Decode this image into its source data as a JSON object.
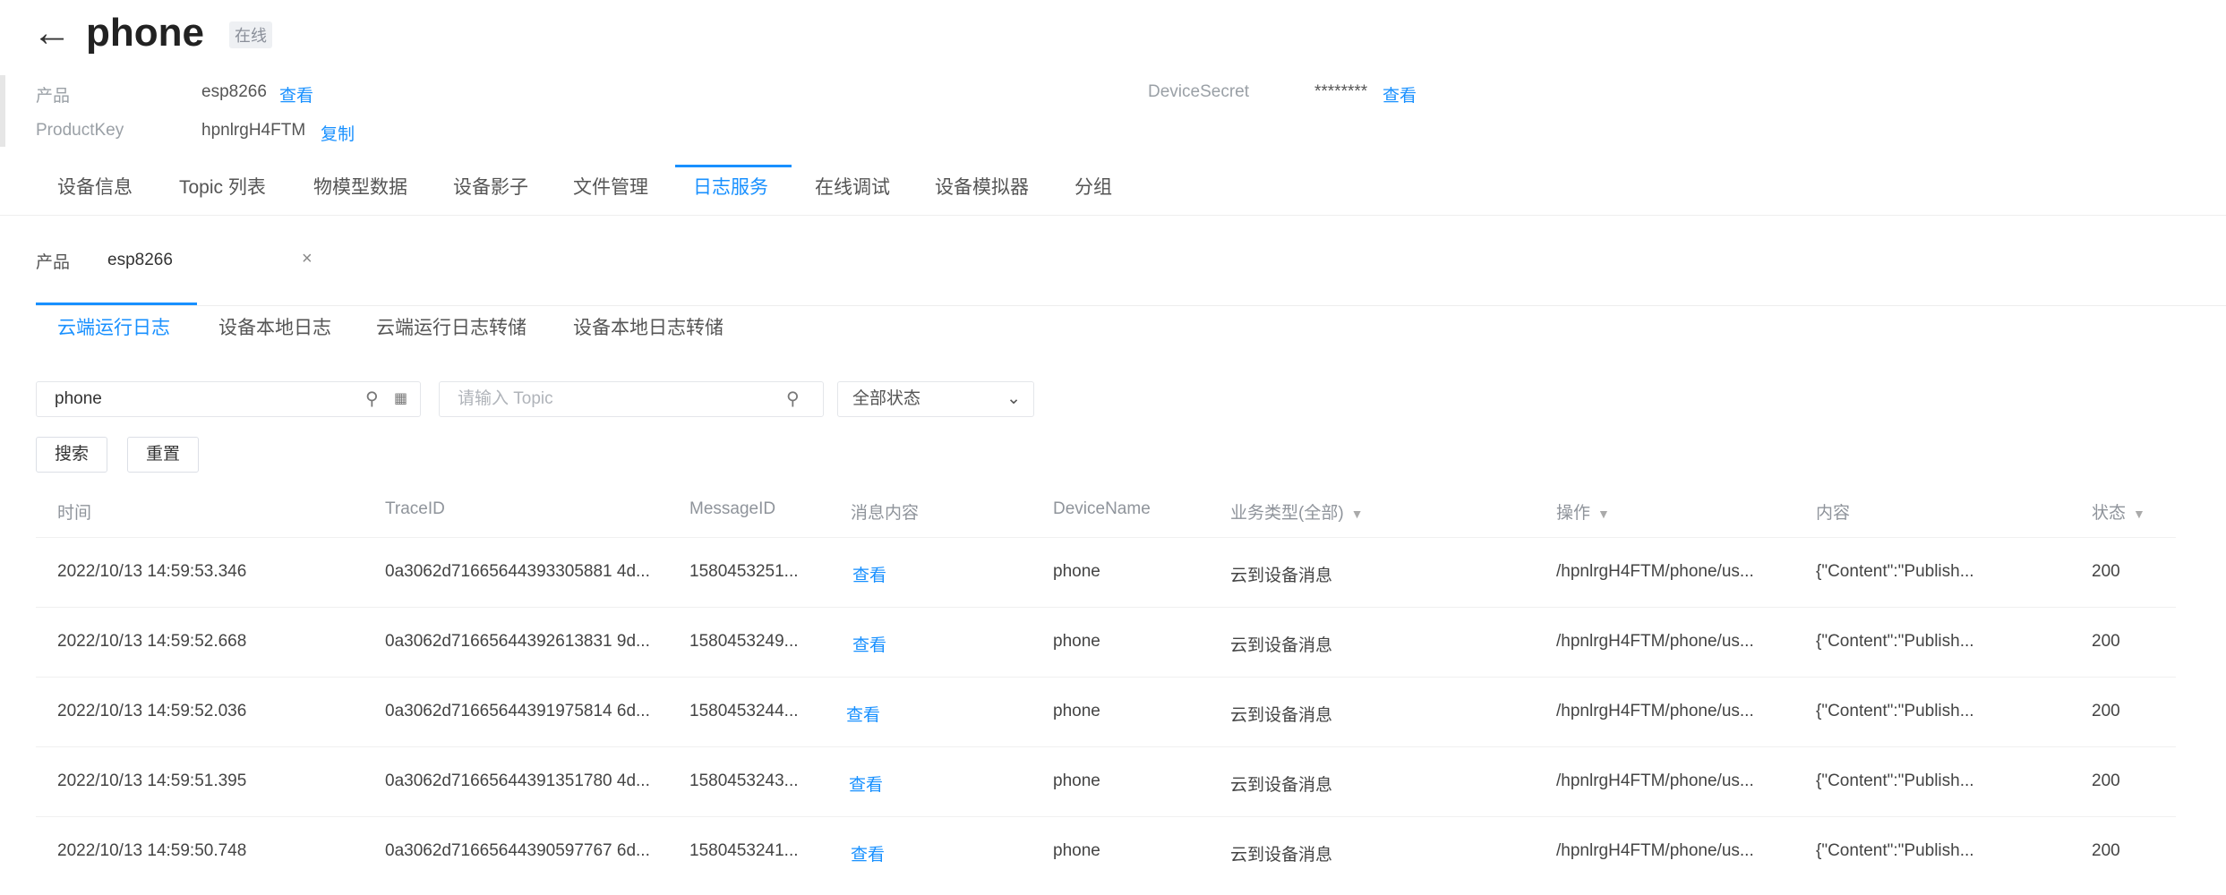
{
  "header": {
    "back_icon": "←",
    "title": "phone",
    "badge": "在线"
  },
  "info": {
    "product_label": "产品",
    "product_value": "esp8266",
    "product_link": "查看",
    "productkey_label": "ProductKey",
    "productkey_value": "hpnlrgH4FTM",
    "productkey_link": "复制",
    "secret_label": "DeviceSecret",
    "secret_value": "********",
    "secret_link": "查看"
  },
  "tabs": [
    "设备信息",
    "Topic 列表",
    "物模型数据",
    "设备影子",
    "文件管理",
    "日志服务",
    "在线调试",
    "设备模拟器",
    "分组"
  ],
  "selector": {
    "label": "产品",
    "value": "esp8266",
    "clear_icon": "×"
  },
  "sub_tabs": [
    "云端运行日志",
    "设备本地日志",
    "云端运行日志转储",
    "设备本地日志转储"
  ],
  "search": {
    "device_value": "phone",
    "topic_placeholder": "请输入 Topic",
    "status_value": "全部状态",
    "search_label": "搜索",
    "reset_label": "重置"
  },
  "table": {
    "headers": [
      "时间",
      "TraceID",
      "MessageID",
      "消息内容",
      "DeviceName",
      "业务类型(全部)",
      "操作",
      "内容",
      "状态"
    ],
    "rows": [
      [
        "2022/10/13 14:59:53.346",
        "0a3062d71665644393305881 4d...",
        "1580453251...",
        "查看",
        "phone",
        "云到设备消息",
        "/hpnlrgH4FTM/phone/us...",
        "{\"Content\":\"Publish...",
        "200"
      ],
      [
        "2022/10/13 14:59:52.668",
        "0a3062d71665644392613831 9d...",
        "1580453249...",
        "查看",
        "phone",
        "云到设备消息",
        "/hpnlrgH4FTM/phone/us...",
        "{\"Content\":\"Publish...",
        "200"
      ],
      [
        "2022/10/13 14:59:52.036",
        "0a3062d71665644391975814 6d...",
        "1580453244...",
        "查看",
        "phone",
        "云到设备消息",
        "/hpnlrgH4FTM/phone/us...",
        "{\"Content\":\"Publish...",
        "200"
      ],
      [
        "2022/10/13 14:59:51.395",
        "0a3062d71665644391351780 4d...",
        "1580453243...",
        "查看",
        "phone",
        "云到设备消息",
        "/hpnlrgH4FTM/phone/us...",
        "{\"Content\":\"Publish...",
        "200"
      ],
      [
        "2022/10/13 14:59:50.748",
        "0a3062d71665644390597767 6d...",
        "1580453241...",
        "查看",
        "phone",
        "云到设备消息",
        "/hpnlrgH4FTM/phone/us...",
        "{\"Content\":\"Publish...",
        "200"
      ]
    ]
  },
  "colors": {
    "accent": "#1890ff",
    "text": "#333333",
    "muted": "#8f949b"
  }
}
